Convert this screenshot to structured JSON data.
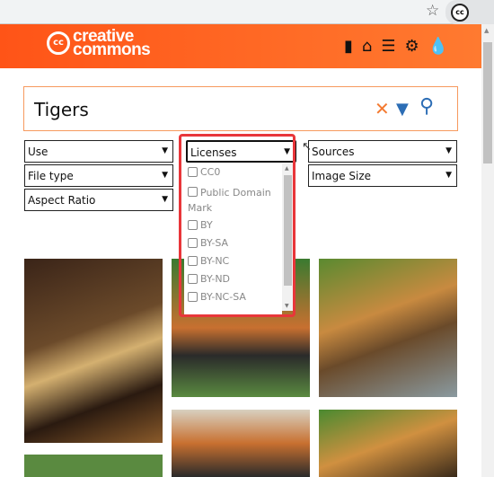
{
  "browser": {
    "star_icon": "star-icon",
    "extension_icon": "creative-commons-icon",
    "extension_label": "cc"
  },
  "header": {
    "logo_cc": "cc",
    "logo_line1": "creative",
    "logo_line2": "commons",
    "icons": [
      "bookmark-icon",
      "home-icon",
      "list-icon",
      "gear-icon",
      "drop-icon"
    ],
    "accent": "#ff5a1f"
  },
  "search": {
    "value": "Tigers",
    "clear_icon": "close-icon",
    "filter_icon": "filter-icon",
    "search_icon": "search-icon"
  },
  "filters": {
    "use": "Use",
    "licenses": "Licenses",
    "sources": "Sources",
    "file_type": "File type",
    "image_size": "Image Size",
    "aspect_ratio": "Aspect Ratio"
  },
  "licenses_options": [
    "CC0",
    "Public Domain Mark",
    "BY",
    "BY-SA",
    "BY-NC",
    "BY-ND",
    "BY-NC-SA"
  ],
  "highlight_color": "#e8363a"
}
